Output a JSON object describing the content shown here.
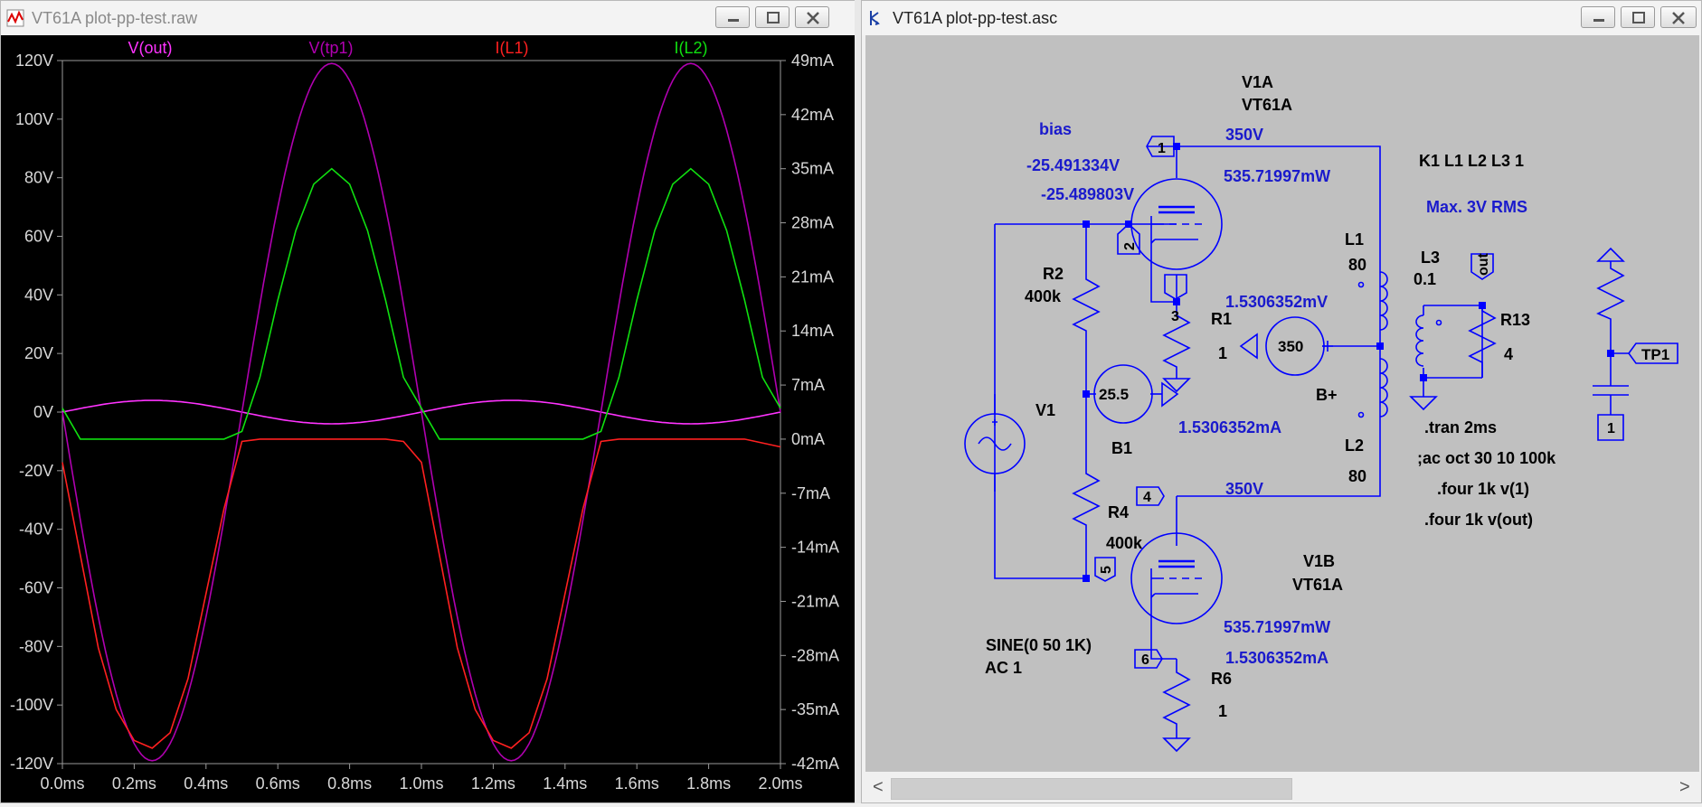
{
  "plot_window": {
    "title": "VT61A plot-pp-test.raw",
    "icon": "waveform-icon",
    "buttons": [
      "minimize-icon",
      "maximize-icon",
      "close-icon"
    ]
  },
  "schematic_window": {
    "title": "VT61A plot-pp-test.asc",
    "icon": "schematic-icon",
    "buttons": [
      "minimize-icon",
      "maximize-icon",
      "close-icon"
    ]
  },
  "chart_data": {
    "type": "line",
    "background": "#000000",
    "series": [
      {
        "name": "V(out)",
        "color": "#ff33ff",
        "axis": "left",
        "x": [
          0,
          0.25,
          0.5,
          0.75,
          1.0,
          1.25,
          1.5,
          1.75,
          2.0
        ],
        "values": [
          0,
          4,
          0,
          -4,
          0,
          4,
          0,
          -4,
          0
        ]
      },
      {
        "name": "V(tp1)",
        "color": "#b000b0",
        "axis": "left",
        "x": [
          0,
          0.25,
          0.5,
          0.75,
          1.0,
          1.25,
          1.5,
          1.75,
          2.0
        ],
        "values": [
          0,
          -118,
          0,
          120,
          0,
          -118,
          0,
          120,
          0
        ]
      },
      {
        "name": "I(L1)",
        "color": "#ff2020",
        "axis": "right",
        "unit": "mA",
        "x": [
          0,
          0.05,
          0.1,
          0.15,
          0.2,
          0.25,
          0.3,
          0.35,
          0.4,
          0.45,
          0.5,
          0.55,
          0.6,
          0.7,
          0.8,
          0.9,
          0.95,
          1.0,
          1.05,
          1.1,
          1.15,
          1.2,
          1.25,
          1.3,
          1.35,
          1.4,
          1.45,
          1.5,
          1.55,
          1.6,
          1.7,
          1.8,
          1.9,
          2.0
        ],
        "values": [
          -3,
          -15,
          -27,
          -35,
          -39,
          -40,
          -38,
          -31,
          -20,
          -9,
          -0.3,
          0,
          0,
          0,
          0,
          0,
          -0.3,
          -3,
          -15,
          -27,
          -35,
          -39,
          -40,
          -38,
          -31,
          -20,
          -9,
          -0.3,
          0,
          0,
          0,
          0,
          0,
          -1
        ]
      },
      {
        "name": "I(L2)",
        "color": "#10e010",
        "axis": "right",
        "unit": "mA",
        "x": [
          0,
          0.05,
          0.1,
          0.15,
          0.2,
          0.25,
          0.3,
          0.35,
          0.4,
          0.45,
          0.5,
          0.55,
          0.6,
          0.65,
          0.7,
          0.75,
          0.8,
          0.85,
          0.9,
          0.95,
          1.0,
          1.05,
          1.1,
          1.15,
          1.2,
          1.25,
          1.3,
          1.35,
          1.4,
          1.45,
          1.5,
          1.55,
          1.6,
          1.65,
          1.7,
          1.75,
          1.8,
          1.85,
          1.9,
          1.95,
          2.0
        ],
        "values": [
          4,
          0,
          0,
          0,
          0,
          0,
          0,
          0,
          0,
          0,
          1,
          8,
          18,
          27,
          33,
          35,
          33,
          27,
          18,
          8,
          4,
          0,
          0,
          0,
          0,
          0,
          0,
          0,
          0,
          0,
          1,
          8,
          18,
          27,
          33,
          35,
          33,
          27,
          18,
          8,
          4
        ]
      }
    ],
    "x_ticks": [
      "0.0ms",
      "0.2ms",
      "0.4ms",
      "0.6ms",
      "0.8ms",
      "1.0ms",
      "1.2ms",
      "1.4ms",
      "1.6ms",
      "1.8ms",
      "2.0ms"
    ],
    "y_left_ticks": [
      "120V",
      "100V",
      "80V",
      "60V",
      "40V",
      "20V",
      "0V",
      "-20V",
      "-40V",
      "-60V",
      "-80V",
      "-100V",
      "-120V"
    ],
    "y_right_ticks": [
      "49mA",
      "42mA",
      "35mA",
      "28mA",
      "21mA",
      "14mA",
      "7mA",
      "0mA",
      "-7mA",
      "-14mA",
      "-21mA",
      "-28mA",
      "-35mA",
      "-42mA"
    ],
    "xlim": [
      0,
      2
    ],
    "ylim_left": [
      -120,
      120
    ],
    "ylim_right": [
      -42,
      49
    ],
    "grid": true
  },
  "schematic": {
    "labels": {
      "v1a_name": "V1A",
      "v1a_model": "VT61A",
      "v1b_name": "V1B",
      "v1b_model": "VT61A",
      "bias": "bias",
      "bias_v1": "-25.491334V",
      "bias_v2": "-25.489803V",
      "power_top": "535.71997mW",
      "power_bottom": "535.71997mW",
      "r1_mv": "1.5306352mV",
      "current_mid": "1.5306352mA",
      "current_bottom": "1.5306352mA",
      "plate_v_top": "350V",
      "plate_v_bottom": "350V",
      "r2": "R2",
      "r2_val": "400k",
      "r4": "R4",
      "r4_val": "400k",
      "r1": "R1",
      "r1_val": "1",
      "r6": "R6",
      "r6_val": "1",
      "r13": "R13",
      "r13_val": "4",
      "l1": "L1",
      "l1_val": "80",
      "l2": "L2",
      "l2_val": "80",
      "l3": "L3",
      "l3_val": "0.1",
      "v1": "V1",
      "b1": "B1",
      "bplus": "B+",
      "b1_val": "25.5",
      "bplus_val": "350",
      "sine": "SINE(0 50 1K)",
      "ac": "AC 1",
      "k": "K1 L1 L2 L3 1",
      "max": "Max. 3V RMS",
      "tran": ".tran 2ms",
      "acoct": ";ac oct 30 10 100k",
      "four1": ".four 1k v(1)",
      "four2": ".four 1k v(out)",
      "n1": "1",
      "n2": "2",
      "n3": "3",
      "n4": "4",
      "n5": "5",
      "n6": "6",
      "out": "out",
      "tp1": "TP1",
      "gnd1": "1"
    },
    "colors": {
      "wire": "#0000ff",
      "text": "#000000",
      "annot": "#1a1acc",
      "bg": "#c0c0c0"
    }
  },
  "scrollbar": {
    "left_arrow": "<",
    "right_arrow": ">"
  }
}
